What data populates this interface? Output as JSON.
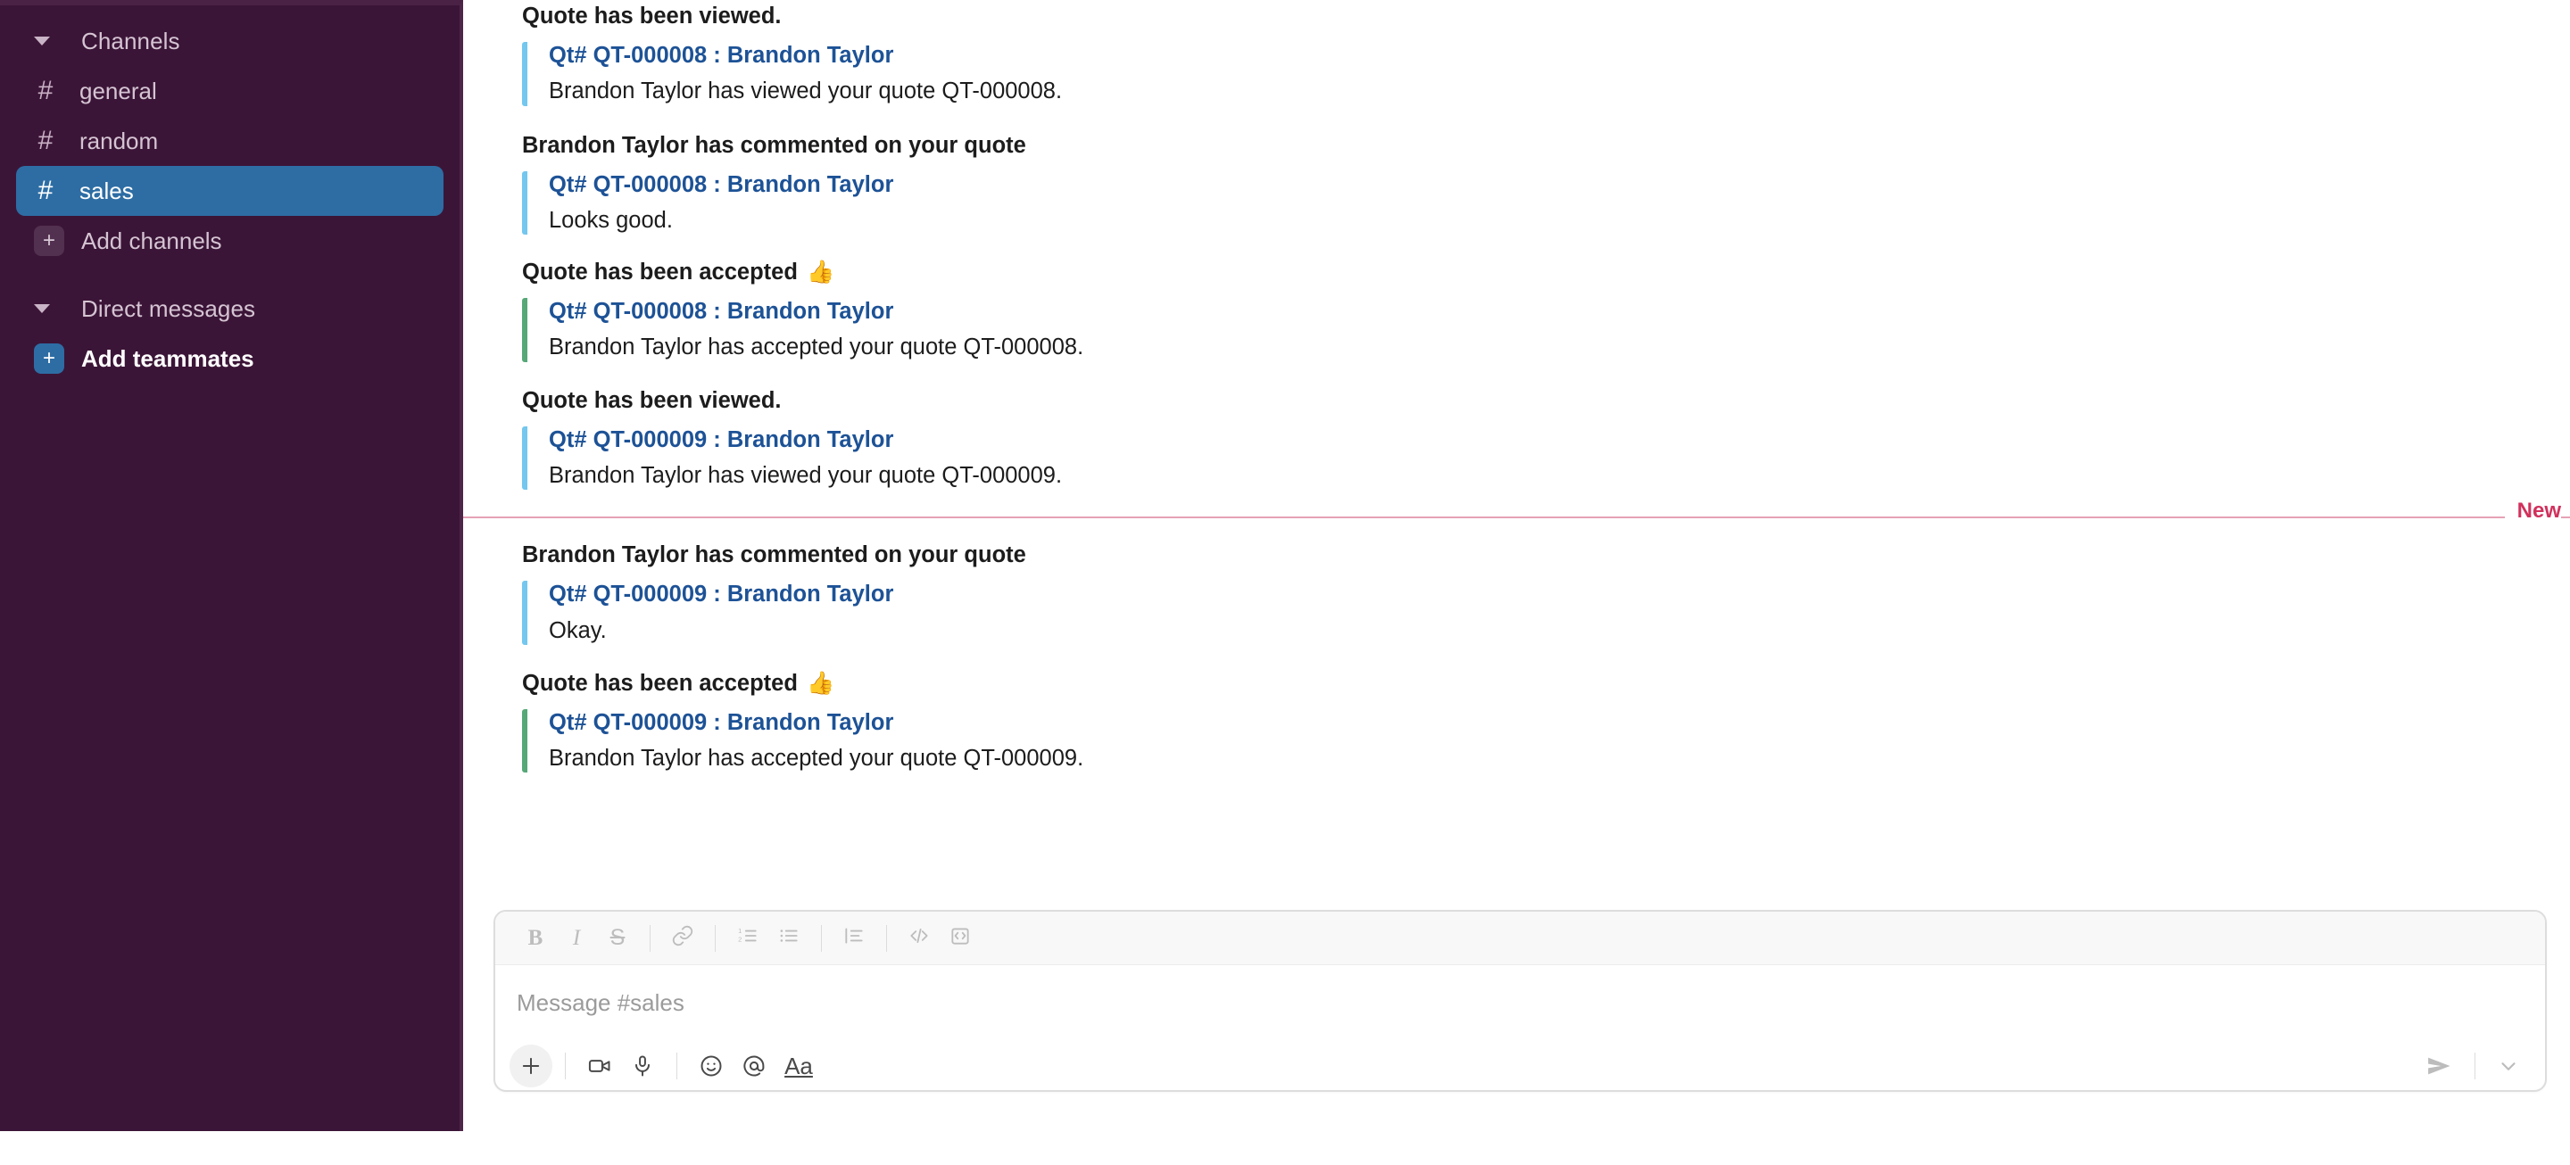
{
  "sidebar": {
    "channels_section": {
      "label": "Channels",
      "caret_icon": "caret-down-icon",
      "items": [
        {
          "hash": "#",
          "label": "general",
          "selected": false
        },
        {
          "hash": "#",
          "label": "random",
          "selected": false
        },
        {
          "hash": "#",
          "label": "sales",
          "selected": true
        }
      ],
      "add": {
        "plus": "+",
        "label": "Add channels"
      }
    },
    "dm_section": {
      "label": "Direct messages",
      "caret_icon": "caret-down-icon",
      "add": {
        "plus": "+",
        "label": "Add teammates"
      }
    },
    "colors": {
      "background": "#3b1537",
      "selected": "#2d6da4",
      "text": "#d5c4d3"
    }
  },
  "conversation": {
    "new_divider_label": "New",
    "new_divider_color": "#d1315c",
    "accent_blue": "#74c7ee",
    "accent_green": "#56a877",
    "link_color": "#1d5296",
    "messages": [
      {
        "title": "Quote has been viewed.",
        "emoji": "",
        "accent": "blue",
        "link": "Qt# QT-000008 : Brandon Taylor",
        "body": "Brandon Taylor has viewed your quote QT-000008."
      },
      {
        "title": "Brandon Taylor has commented on your quote",
        "emoji": "",
        "accent": "blue",
        "link": "Qt# QT-000008 : Brandon Taylor",
        "body": "Looks good."
      },
      {
        "title": "Quote has been accepted",
        "emoji": "👍",
        "accent": "green",
        "link": "Qt# QT-000008 : Brandon Taylor",
        "body": "Brandon Taylor has accepted your quote QT-000008."
      },
      {
        "title": "Quote has been viewed.",
        "emoji": "",
        "accent": "blue",
        "link": "Qt# QT-000009 : Brandon Taylor",
        "body": "Brandon Taylor has viewed your quote QT-000009."
      },
      {
        "title": "Brandon Taylor has commented on your quote",
        "emoji": "",
        "accent": "blue",
        "link": "Qt# QT-000009 : Brandon Taylor",
        "body": "Okay."
      },
      {
        "title": "Quote has been accepted",
        "emoji": "👍",
        "accent": "green",
        "link": "Qt# QT-000009 : Brandon Taylor",
        "body": "Brandon Taylor has accepted your quote QT-000009."
      }
    ]
  },
  "composer": {
    "placeholder": "Message #sales",
    "value": "",
    "format_buttons": [
      {
        "name": "bold-icon",
        "glyph": "B"
      },
      {
        "name": "italic-icon",
        "glyph": "I"
      },
      {
        "name": "strikethrough-icon",
        "glyph": "S"
      },
      {
        "name": "link-icon",
        "glyph": "link"
      },
      {
        "name": "ordered-list-icon",
        "glyph": "ol"
      },
      {
        "name": "bulleted-list-icon",
        "glyph": "ul"
      },
      {
        "name": "blockquote-icon",
        "glyph": "quote"
      },
      {
        "name": "code-icon",
        "glyph": "</>"
      },
      {
        "name": "code-block-icon",
        "glyph": "codeblock"
      }
    ],
    "action_buttons": [
      {
        "name": "add-attachment-button",
        "glyph": "+"
      },
      {
        "name": "video-icon",
        "glyph": "video"
      },
      {
        "name": "microphone-icon",
        "glyph": "mic"
      },
      {
        "name": "emoji-icon",
        "glyph": "smiley"
      },
      {
        "name": "mention-icon",
        "glyph": "@"
      },
      {
        "name": "formatting-icon",
        "glyph": "Aa"
      }
    ],
    "send_label": "Aa",
    "send_icon": "send-icon",
    "send_options_icon": "chevron-down-icon"
  }
}
